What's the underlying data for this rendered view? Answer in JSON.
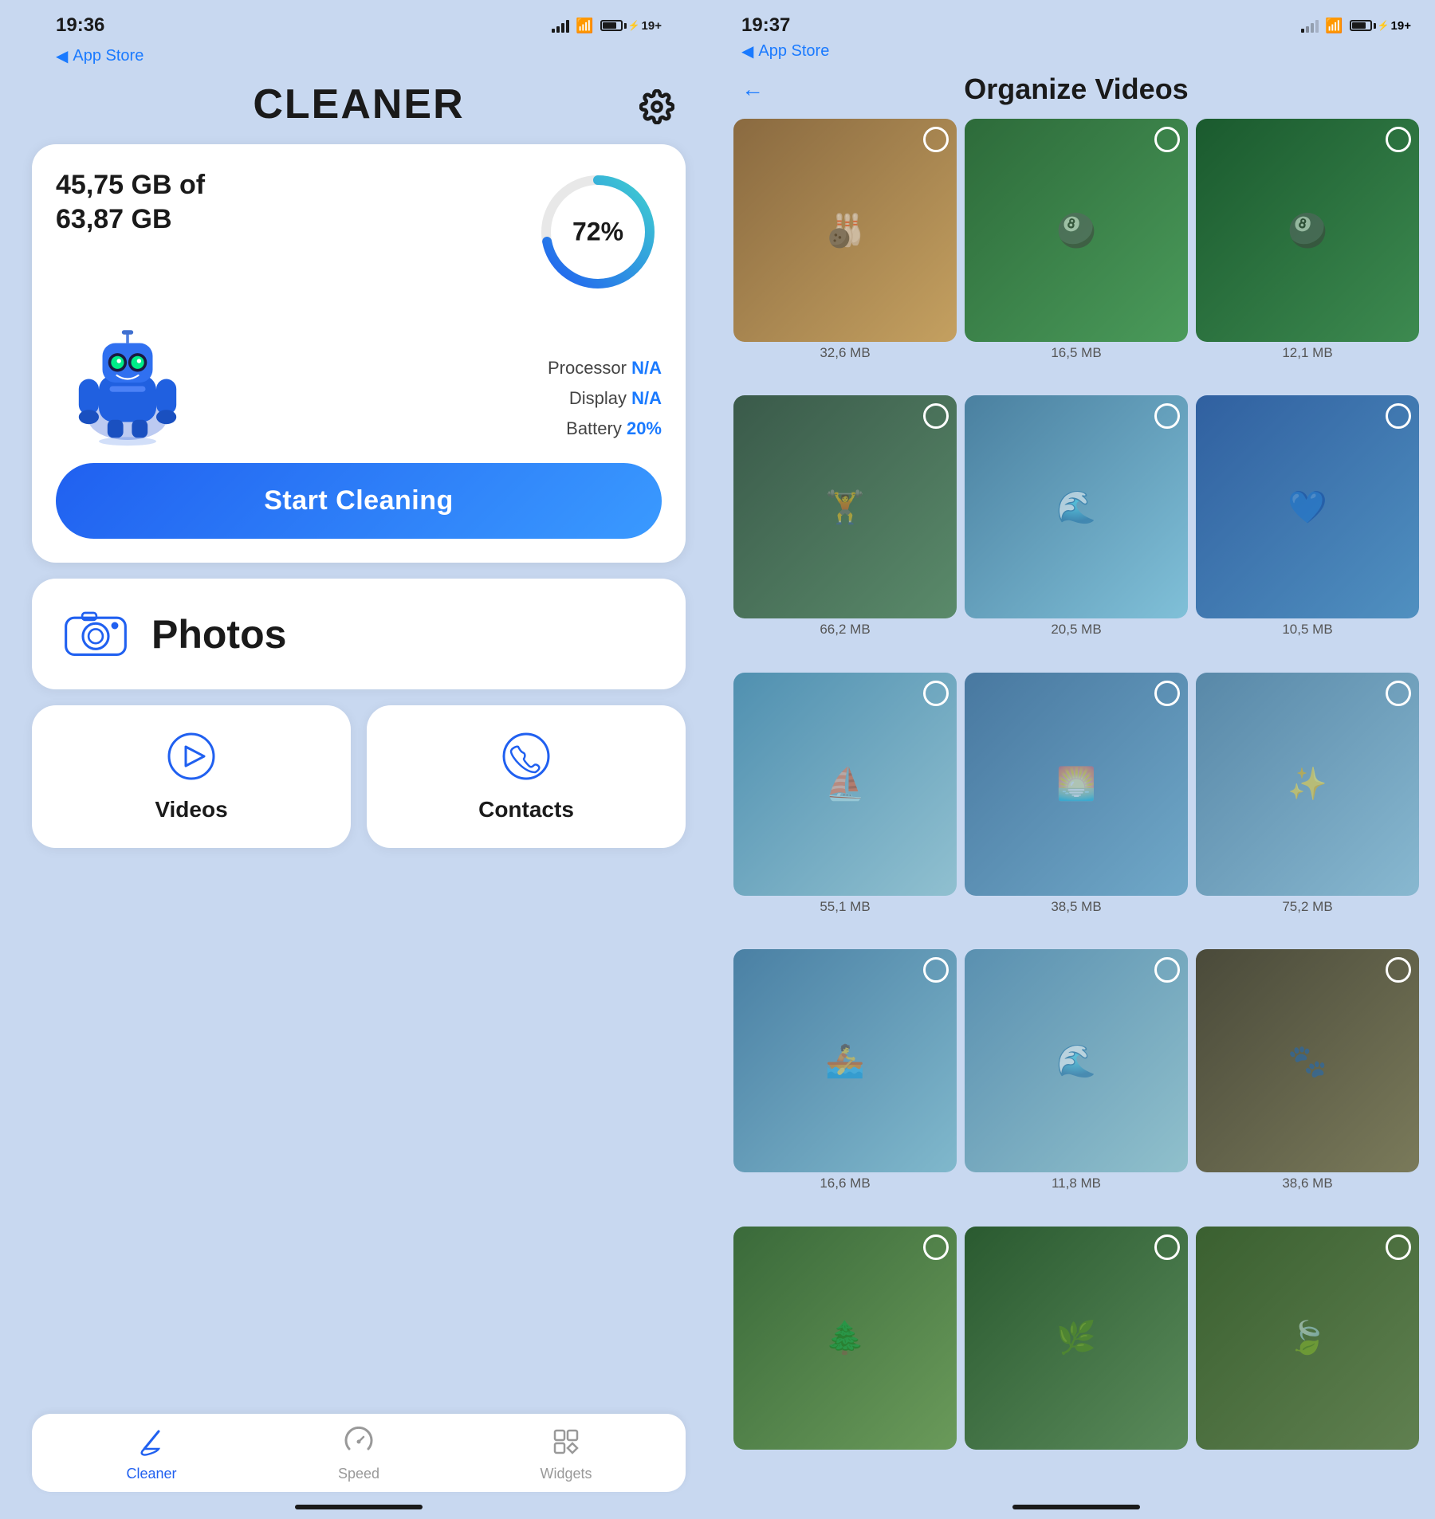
{
  "left": {
    "status": {
      "time": "19:36",
      "appstore": "App Store",
      "battery_label": "19+"
    },
    "header": {
      "title": "CLEANER",
      "gear_label": "settings"
    },
    "storage": {
      "used": "45,75 GB of",
      "total": "63,87 GB",
      "percent": "72%",
      "percent_num": 72
    },
    "stats": [
      {
        "label": "Processor",
        "value": "N/A"
      },
      {
        "label": "Display",
        "value": "N/A"
      },
      {
        "label": "Battery",
        "value": "20%"
      }
    ],
    "start_button": "Start Cleaning",
    "photos_label": "Photos",
    "videos_label": "Videos",
    "contacts_label": "Contacts",
    "tabs": [
      {
        "label": "Cleaner",
        "active": true
      },
      {
        "label": "Speed",
        "active": false
      },
      {
        "label": "Widgets",
        "active": false
      }
    ]
  },
  "right": {
    "status": {
      "time": "19:37",
      "appstore": "App Store",
      "battery_label": "19+"
    },
    "header": {
      "back": "←",
      "title": "Organize Videos"
    },
    "videos": [
      {
        "size": "32,6 MB",
        "thumb_class": "thumb-bowling",
        "emoji": "🎳"
      },
      {
        "size": "16,5 MB",
        "thumb_class": "thumb-billiards",
        "emoji": "🎱"
      },
      {
        "size": "12,1 MB",
        "thumb_class": "thumb-billiards2",
        "emoji": "🎱"
      },
      {
        "size": "66,2 MB",
        "thumb_class": "thumb-gym",
        "emoji": "🏋"
      },
      {
        "size": "20,5 MB",
        "thumb_class": "thumb-lake",
        "emoji": "🌊"
      },
      {
        "size": "10,5 MB",
        "thumb_class": "thumb-blue1",
        "emoji": "💙"
      },
      {
        "size": "55,1 MB",
        "thumb_class": "thumb-lake2",
        "emoji": "⛵"
      },
      {
        "size": "38,5 MB",
        "thumb_class": "thumb-lake3",
        "emoji": "🌅"
      },
      {
        "size": "75,2 MB",
        "thumb_class": "thumb-glitter",
        "emoji": "✨"
      },
      {
        "size": "16,6 MB",
        "thumb_class": "thumb-lake4",
        "emoji": "🚣"
      },
      {
        "size": "11,8 MB",
        "thumb_class": "thumb-lake5",
        "emoji": "🌊"
      },
      {
        "size": "38,6 MB",
        "thumb_class": "thumb-animal",
        "emoji": "🐾"
      },
      {
        "size": "",
        "thumb_class": "thumb-forest1",
        "emoji": "🌲"
      },
      {
        "size": "",
        "thumb_class": "thumb-forest2",
        "emoji": "🌿"
      },
      {
        "size": "",
        "thumb_class": "thumb-forest3",
        "emoji": "🍃"
      }
    ]
  }
}
